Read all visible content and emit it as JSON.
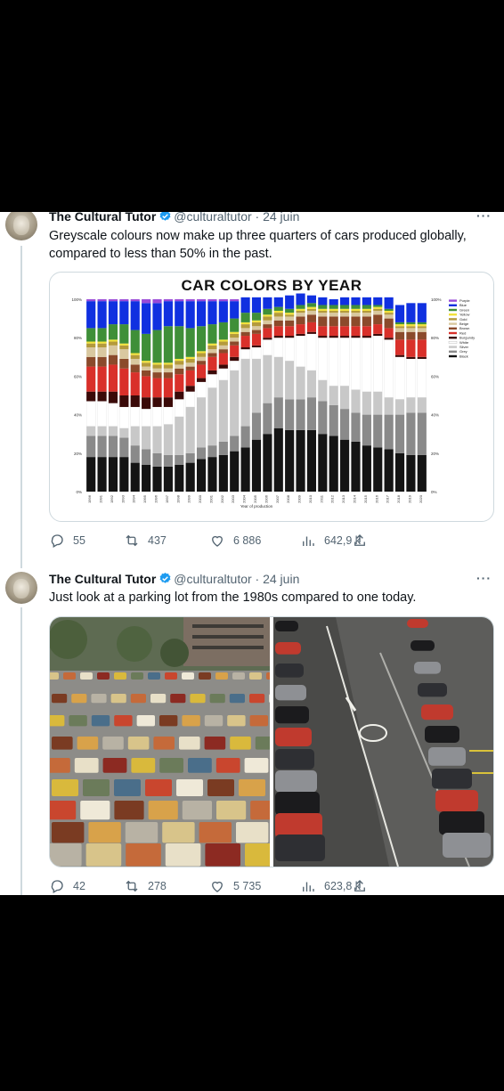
{
  "tweets": [
    {
      "name": "The Cultural Tutor",
      "handle": "@culturaltutor",
      "date": "· 24 juin",
      "more": "···",
      "text": "Greyscale colours now make up three quarters of cars produced globally, compared to less than 50% in the past.",
      "stats": {
        "replies": "55",
        "retweets": "437",
        "likes": "6 886",
        "views": "642,9 k"
      }
    },
    {
      "name": "The Cultural Tutor",
      "handle": "@culturaltutor",
      "date": "· 24 juin",
      "more": "···",
      "text": "Just look at a parking lot from the 1980s compared to one today.",
      "stats": {
        "replies": "42",
        "retweets": "278",
        "likes": "5 735",
        "views": "623,8 k"
      }
    }
  ],
  "icons": [
    "verified-badge-icon",
    "reply-icon",
    "retweet-icon",
    "like-icon",
    "views-icon",
    "share-icon"
  ],
  "colors": {
    "verified": "#1d9bf0",
    "text": "#0f1419",
    "muted": "#536471",
    "border": "#cfd9de"
  },
  "chart_data": {
    "type": "bar",
    "stacked": true,
    "title": "CAR COLORS BY YEAR",
    "xlabel": "Year of production",
    "ylabel": "",
    "ylim": [
      0,
      100
    ],
    "yticks": [
      "0%",
      "20%",
      "40%",
      "60%",
      "80%",
      "100%"
    ],
    "legend_position": "right",
    "categories": [
      "1996",
      "1991",
      "1992",
      "1993",
      "1994",
      "1995",
      "1996",
      "1997",
      "1998",
      "1999",
      "2000",
      "2001",
      "2002",
      "2003",
      "2004",
      "2005",
      "2006",
      "2007",
      "2008",
      "2009",
      "2010",
      "2011",
      "2012",
      "2013",
      "2014",
      "2015",
      "2016",
      "2017",
      "2018",
      "2019",
      "2020"
    ],
    "series": [
      {
        "name": "Black",
        "color": "#141414",
        "values": [
          18,
          18,
          18,
          18,
          15,
          14,
          13,
          13,
          14,
          15,
          17,
          18,
          19,
          21,
          23,
          27,
          30,
          33,
          32,
          32,
          32,
          30,
          29,
          27,
          26,
          24,
          23,
          22,
          20,
          19,
          19
        ]
      },
      {
        "name": "Grey",
        "color": "#8a8a8a",
        "values": [
          11,
          11,
          11,
          10,
          9,
          8,
          7,
          6,
          5,
          5,
          6,
          6,
          7,
          8,
          11,
          14,
          16,
          16,
          16,
          16,
          17,
          17,
          16,
          16,
          15,
          16,
          17,
          18,
          20,
          22,
          22
        ]
      },
      {
        "name": "Silver",
        "color": "#c8c8c8",
        "values": [
          5,
          5,
          5,
          5,
          10,
          12,
          14,
          16,
          20,
          24,
          26,
          30,
          32,
          34,
          35,
          28,
          25,
          21,
          20,
          17,
          14,
          11,
          10,
          12,
          12,
          12,
          12,
          9,
          8,
          8,
          8
        ]
      },
      {
        "name": "White",
        "color": "#ffffff",
        "values": [
          13,
          13,
          12,
          11,
          10,
          9,
          10,
          9,
          9,
          8,
          8,
          7,
          6,
          5,
          5,
          6,
          8,
          10,
          12,
          16,
          19,
          22,
          25,
          25,
          27,
          28,
          29,
          30,
          22,
          20,
          20
        ]
      },
      {
        "name": "Burgundy",
        "color": "#3a0a08",
        "values": [
          5,
          5,
          6,
          6,
          6,
          6,
          5,
          5,
          4,
          3,
          2,
          2,
          2,
          2,
          1,
          1,
          1,
          1,
          1,
          1,
          1,
          1,
          1,
          1,
          1,
          1,
          1,
          1,
          1,
          1,
          1
        ]
      },
      {
        "name": "Red",
        "color": "#d9302a",
        "values": [
          13,
          13,
          14,
          14,
          12,
          11,
          10,
          10,
          9,
          8,
          7,
          7,
          6,
          6,
          6,
          6,
          5,
          5,
          5,
          5,
          5,
          5,
          5,
          5,
          5,
          5,
          5,
          5,
          8,
          9,
          9
        ]
      },
      {
        "name": "Brown",
        "color": "#8b4a2b",
        "values": [
          5,
          5,
          5,
          5,
          4,
          3,
          3,
          3,
          3,
          2,
          2,
          2,
          2,
          2,
          2,
          2,
          2,
          3,
          3,
          4,
          4,
          5,
          5,
          5,
          5,
          5,
          5,
          5,
          4,
          4,
          4
        ]
      },
      {
        "name": "Beige",
        "color": "#d9c8a0",
        "values": [
          5,
          5,
          5,
          5,
          3,
          2,
          2,
          2,
          2,
          2,
          2,
          2,
          2,
          2,
          2,
          2,
          2,
          2,
          2,
          2,
          2,
          2,
          2,
          2,
          2,
          2,
          2,
          2,
          2,
          2,
          2
        ]
      },
      {
        "name": "Gold",
        "color": "#b49a3c",
        "values": [
          2,
          2,
          2,
          2,
          2,
          2,
          2,
          2,
          2,
          2,
          2,
          2,
          2,
          2,
          2,
          2,
          2,
          2,
          1,
          1,
          1,
          1,
          1,
          1,
          1,
          1,
          1,
          1,
          1,
          1,
          1
        ]
      },
      {
        "name": "Yellow",
        "color": "#f2e23a",
        "values": [
          1,
          1,
          1,
          1,
          1,
          1,
          1,
          1,
          1,
          1,
          1,
          1,
          1,
          1,
          1,
          1,
          1,
          1,
          1,
          1,
          1,
          1,
          1,
          1,
          1,
          1,
          1,
          1,
          1,
          1,
          1
        ]
      },
      {
        "name": "Green",
        "color": "#3f8f38",
        "values": [
          7,
          7,
          8,
          10,
          12,
          14,
          17,
          19,
          17,
          15,
          13,
          10,
          9,
          7,
          5,
          4,
          3,
          2,
          2,
          2,
          2,
          2,
          2,
          2,
          2,
          2,
          1,
          1,
          1,
          1,
          1
        ]
      },
      {
        "name": "Blue",
        "color": "#1030e0",
        "values": [
          14,
          14,
          12,
          12,
          15,
          16,
          14,
          13,
          13,
          14,
          13,
          12,
          11,
          9,
          8,
          8,
          6,
          5,
          7,
          6,
          4,
          4,
          3,
          4,
          4,
          4,
          4,
          6,
          9,
          10,
          10
        ]
      },
      {
        "name": "Purple",
        "color": "#9a4ad8",
        "values": [
          1,
          1,
          1,
          1,
          1,
          2,
          2,
          1,
          1,
          1,
          1,
          1,
          1,
          1,
          0,
          0,
          0,
          0,
          0,
          0,
          0,
          0,
          0,
          0,
          0,
          0,
          0,
          0,
          0,
          0,
          0
        ]
      }
    ]
  }
}
